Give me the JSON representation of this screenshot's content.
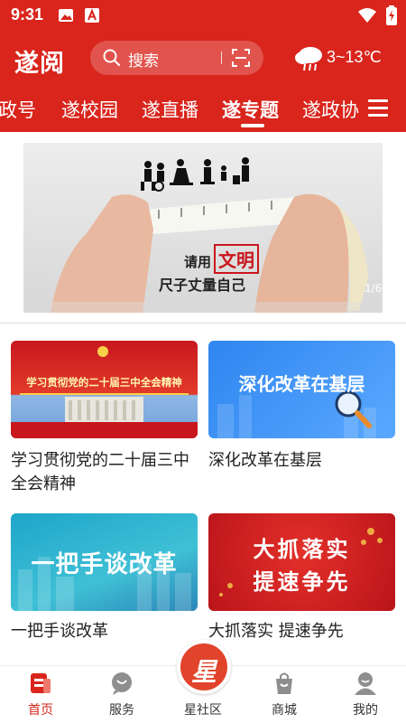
{
  "status": {
    "time": "9:31"
  },
  "header": {
    "logo": "遂阅",
    "search_placeholder": "搜索",
    "weather": "3~13℃"
  },
  "tabs": [
    {
      "label": "政号"
    },
    {
      "label": "遂校园"
    },
    {
      "label": "遂直播"
    },
    {
      "label": "遂专题",
      "active": true
    },
    {
      "label": "遂政协"
    }
  ],
  "banner": {
    "caption_prefix": "请用",
    "caption_highlight": "文明",
    "caption_line2": "尺子丈量自己",
    "counter": "1/6"
  },
  "cards": [
    {
      "title": "学习贯彻党的二十届三中全会精神",
      "thumb_text": "学习贯彻党的二十届三中全会精神"
    },
    {
      "title": "深化改革在基层",
      "thumb_text": "深化改革在基层"
    },
    {
      "title": "一把手谈改革",
      "thumb_text": "一把手谈改革"
    },
    {
      "title": "大抓落实 提速争先",
      "thumb_text_1": "大抓落实",
      "thumb_text_2": "提速争先"
    }
  ],
  "bottom_nav": [
    {
      "label": "首页",
      "icon": "home-news-icon",
      "active": true
    },
    {
      "label": "服务",
      "icon": "service-chat-icon"
    },
    {
      "label": "星社区",
      "icon": "star-community-icon",
      "badge": "星"
    },
    {
      "label": "商城",
      "icon": "shopping-bag-icon"
    },
    {
      "label": "我的",
      "icon": "user-profile-icon"
    }
  ],
  "colors": {
    "brand_red": "#d9251c",
    "nav_active": "#d9251c"
  }
}
